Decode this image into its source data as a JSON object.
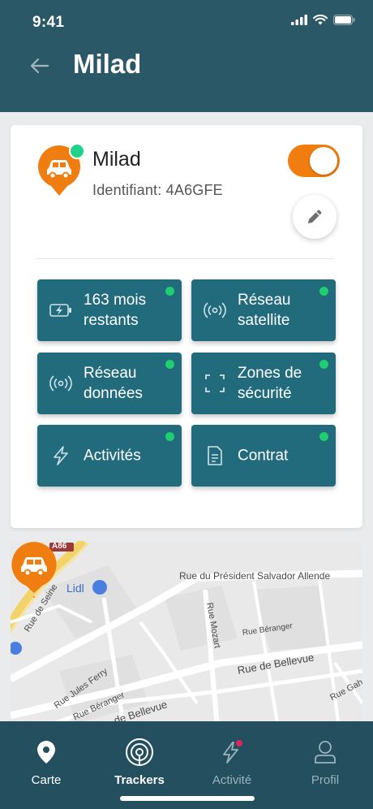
{
  "status_bar": {
    "time": "9:41"
  },
  "header": {
    "title": "Milad"
  },
  "tracker": {
    "name": "Milad",
    "identifier": "Identifiant: 4A6GFE",
    "enabled": true
  },
  "tiles": [
    {
      "label": "163 mois\nrestants",
      "icon": "battery-charging-icon",
      "status": "active"
    },
    {
      "label": "Réseau\nsatellite",
      "icon": "signal-icon",
      "status": "active"
    },
    {
      "label": "Réseau\ndonnées",
      "icon": "signal-icon",
      "status": "active"
    },
    {
      "label": "Zones de\nsécurité",
      "icon": "zone-frame-icon",
      "status": "active"
    },
    {
      "label": "Activités",
      "icon": "bolt-icon",
      "status": "active"
    },
    {
      "label": "Contrat",
      "icon": "document-icon",
      "status": "active"
    }
  ],
  "map": {
    "labels": {
      "a86": "A86",
      "lidl": "Lidl",
      "president": "Rue du Président Salvador Allende",
      "seine": "Rue de Seine",
      "mozart": "Rue Mozart",
      "beranger_1": "Rue Béranger",
      "bellevue_1": "Rue de Bellevue",
      "jules_ferry": "Rue Jules Ferry",
      "beranger_2": "Rue Béranger",
      "bellevue_2": "de Bellevue",
      "gah": "Rue Gah"
    }
  },
  "nav": {
    "items": [
      {
        "label": "Carte",
        "icon": "map-pin-icon",
        "active": true
      },
      {
        "label": "Trackers",
        "icon": "broadcast-icon",
        "active": true
      },
      {
        "label": "Activité",
        "icon": "bolt-icon",
        "active": false,
        "notification": true
      },
      {
        "label": "Profil",
        "icon": "user-icon",
        "active": false
      }
    ]
  },
  "colors": {
    "header": "#2b5867",
    "tile": "#216b7d",
    "accent": "#f07d10",
    "status_green": "#1fcf6f",
    "nav": "#234f5e"
  }
}
